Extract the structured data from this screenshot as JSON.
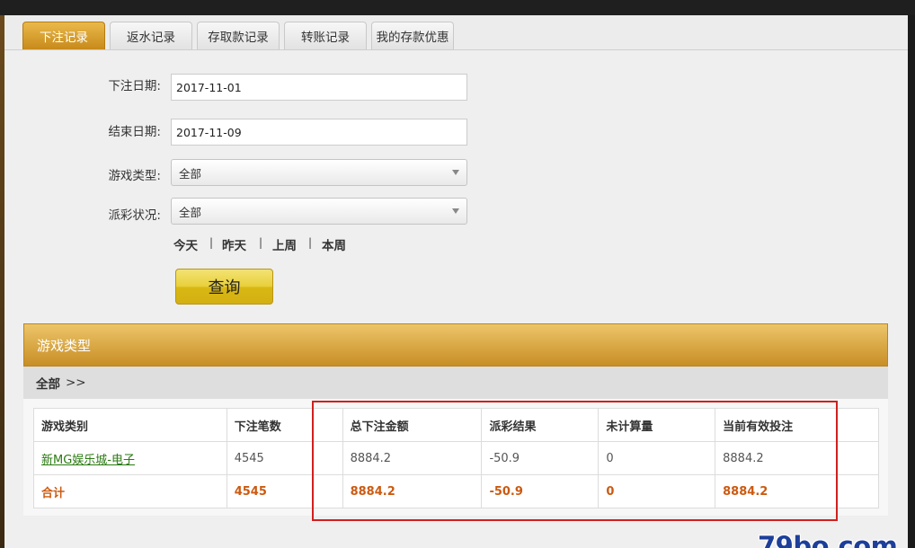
{
  "tabs": [
    {
      "label": "下注记录",
      "active": true
    },
    {
      "label": "返水记录",
      "active": false
    },
    {
      "label": "存取款记录",
      "active": false
    },
    {
      "label": "转账记录",
      "active": false
    },
    {
      "label": "我的存款优惠",
      "active": false
    }
  ],
  "form": {
    "start_date": {
      "label": "下注日期:",
      "value": "2017-11-01"
    },
    "end_date": {
      "label": "结束日期:",
      "value": "2017-11-09"
    },
    "game_type": {
      "label": "游戏类型:",
      "value": "全部"
    },
    "payout_status": {
      "label": "派彩状况:",
      "value": "全部"
    },
    "quick_ranges": [
      "今天",
      "昨天",
      "上周",
      "本周"
    ],
    "separator": "|",
    "query_label": "查询"
  },
  "game_type_section": {
    "title": "游戏类型",
    "breadcrumb": "全部",
    "breadcrumb_arrow": ">>"
  },
  "table": {
    "headers": [
      "游戏类别",
      "下注笔数",
      "总下注金额",
      "派彩结果",
      "未计算量",
      "当前有效投注"
    ],
    "rows": [
      {
        "game": "新MG娱乐城-电子",
        "count": "4545",
        "total_bet": "8884.2",
        "payout": "-50.9",
        "unsettled": "0",
        "valid_bet": "8884.2"
      }
    ],
    "total": {
      "label": "合计",
      "count": "4545",
      "total_bet": "8884.2",
      "payout": "-50.9",
      "unsettled": "0",
      "valid_bet": "8884.2"
    }
  },
  "watermark": "79bo.com",
  "colors": {
    "tab_active": "#d99f2e",
    "highlight_box": "#d21f1f",
    "total_text": "#cc5a10",
    "link": "#2a7a10"
  }
}
